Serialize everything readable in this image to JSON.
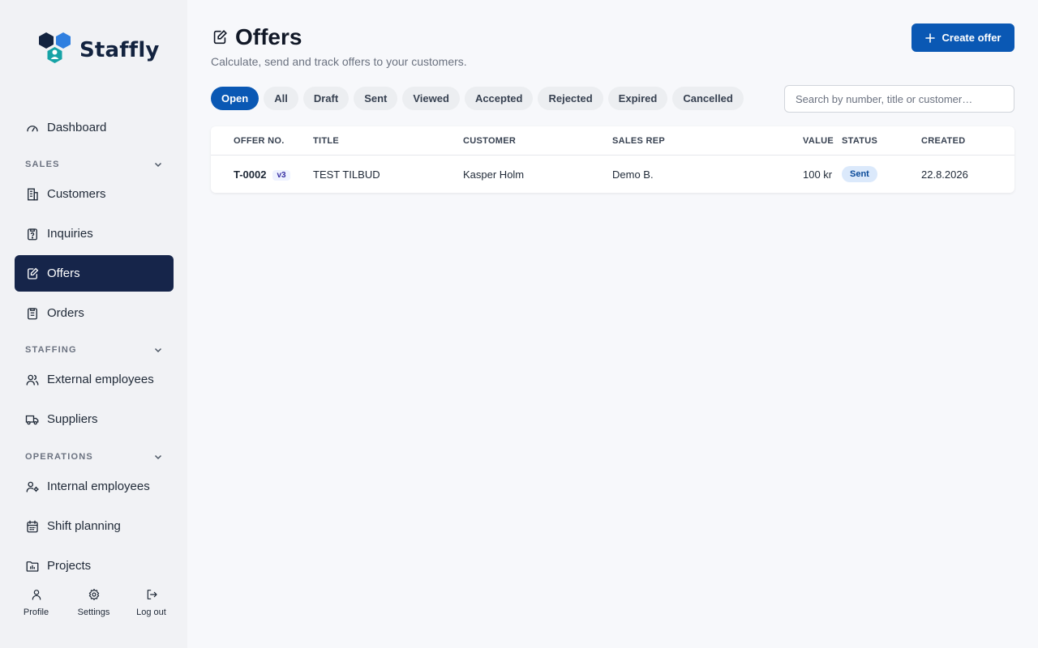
{
  "brand": {
    "name": "Staffly"
  },
  "sidebar": {
    "dashboard": "Dashboard",
    "sections": [
      {
        "label": "SALES",
        "items": [
          "Customers",
          "Inquiries",
          "Offers",
          "Orders"
        ]
      },
      {
        "label": "STAFFING",
        "items": [
          "External employees",
          "Suppliers"
        ]
      },
      {
        "label": "OPERATIONS",
        "items": [
          "Internal employees",
          "Shift planning",
          "Projects"
        ]
      }
    ],
    "active_item": "Offers"
  },
  "bottom": {
    "profile": "Profile",
    "settings": "Settings",
    "logout": "Log out"
  },
  "page": {
    "title": "Offers",
    "subtitle": "Calculate, send and track offers to your customers.",
    "create_label": "Create offer"
  },
  "filters": [
    "Open",
    "All",
    "Draft",
    "Sent",
    "Viewed",
    "Accepted",
    "Rejected",
    "Expired",
    "Cancelled"
  ],
  "active_filter": "Open",
  "search": {
    "placeholder": "Search by number, title or customer…"
  },
  "table": {
    "columns": [
      "OFFER NO.",
      "TITLE",
      "CUSTOMER",
      "SALES REP",
      "VALUE",
      "STATUS",
      "CREATED"
    ],
    "rows": [
      {
        "offer_no": "T-0002",
        "version": "v3",
        "title": "TEST TILBUD",
        "customer": "Kasper Holm",
        "sales_rep": "Demo B.",
        "value": "100 kr",
        "status": "Sent",
        "created": "22.8.2026"
      }
    ]
  },
  "colors": {
    "accent": "#0a58b4",
    "sidebar_active": "#16254a",
    "logo_dark": "#13233f",
    "logo_blue": "#2f7fe0",
    "logo_teal": "#16a3a6"
  }
}
